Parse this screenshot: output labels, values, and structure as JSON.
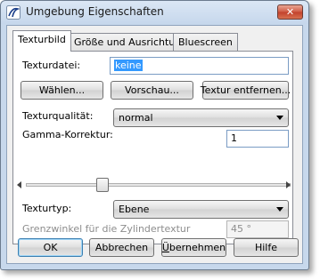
{
  "window": {
    "title": "Umgebung Eigenschaften",
    "close_label": "✕",
    "icon": "app-swirl-icon"
  },
  "tabs": [
    {
      "label": "Texturbild",
      "active": true
    },
    {
      "label": "Größe und Ausrichtung",
      "active": false
    },
    {
      "label": "Bluescreen",
      "active": false
    }
  ],
  "panel": {
    "texture_file_label": "Texturdatei:",
    "texture_file_value": "keine",
    "choose_button": "Wählen...",
    "preview_button": "Vorschau...",
    "remove_button": "Textur entfernen...",
    "quality_label": "Texturqualität:",
    "quality_value": "normal",
    "gamma_label": "Gamma-Korrektur:",
    "gamma_value": "1",
    "gamma_slider_fraction": 0.28,
    "texture_type_label": "Texturtyp:",
    "texture_type_value": "Ebene",
    "cylinder_angle_label": "Grenzwinkel für die Zylindertextur",
    "cylinder_angle_value": "45 °"
  },
  "footer": {
    "ok": "OK",
    "cancel": "Abbrechen",
    "apply_prefix": "Ü",
    "apply_rest": "bernehmen",
    "help": "Hilfe"
  }
}
